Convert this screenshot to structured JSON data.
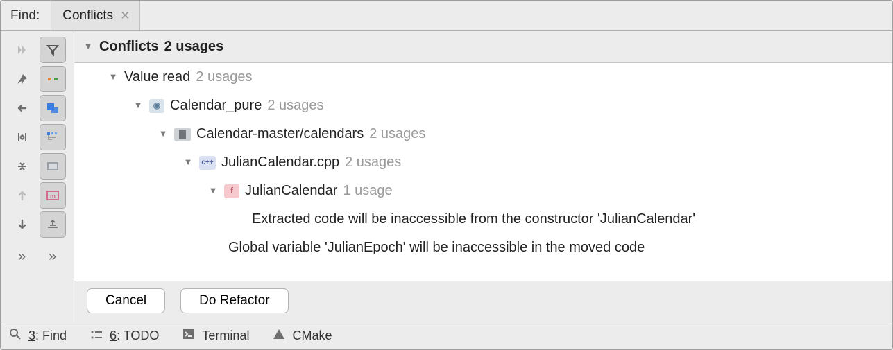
{
  "header": {
    "find_label": "Find:",
    "tab_label": "Conflicts"
  },
  "tree": {
    "root": {
      "label": "Conflicts",
      "usages": "2 usages"
    },
    "value_read": {
      "label": "Value read",
      "usages": "2 usages"
    },
    "project": {
      "label": "Calendar_pure",
      "usages": "2 usages"
    },
    "dir": {
      "label": "Calendar-master/calendars",
      "usages": "2 usages"
    },
    "file": {
      "label": "JulianCalendar.cpp",
      "usages": "2 usages",
      "icon_text": "c++"
    },
    "func": {
      "label": "JulianCalendar",
      "usages": "1 usage",
      "icon_text": "f"
    },
    "msg1": "Extracted code will be inaccessible from the constructor 'JulianCalendar'",
    "msg2": "Global variable 'JulianEpoch' will be inaccessible in the moved code"
  },
  "buttons": {
    "cancel": "Cancel",
    "do_refactor": "Do Refactor"
  },
  "status": {
    "find_key": "3",
    "find_text": ": Find",
    "todo_key": "6",
    "todo_text": ": TODO",
    "terminal": "Terminal",
    "cmake": "CMake"
  }
}
